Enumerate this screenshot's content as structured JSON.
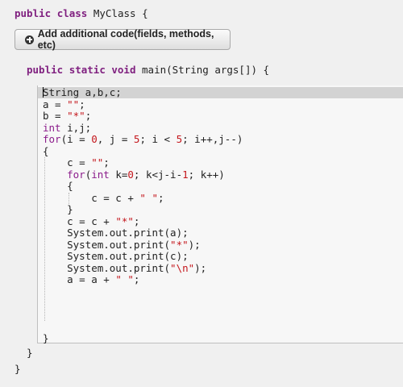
{
  "header": {
    "kw_public": "public",
    "kw_class": "class",
    "class_name": "MyClass",
    "open_brace": "{"
  },
  "add_button": {
    "label": "Add additional code(fields, methods, etc)",
    "icon": "plus-circle-icon"
  },
  "method": {
    "kw_public": "public",
    "kw_static": "static",
    "kw_void": "void",
    "signature": "main(String args[]) {",
    "close_brace": "}"
  },
  "class_close": "}",
  "editor": {
    "lines": [
      [
        {
          "t": "String a,b,c;",
          "c": "plain",
          "cursor": true
        }
      ],
      [
        {
          "t": "a = ",
          "c": "plain"
        },
        {
          "t": "\"\"",
          "c": "str"
        },
        {
          "t": ";",
          "c": "plain"
        }
      ],
      [
        {
          "t": "b = ",
          "c": "plain"
        },
        {
          "t": "\"*\"",
          "c": "str"
        },
        {
          "t": ";",
          "c": "plain"
        }
      ],
      [
        {
          "t": "int",
          "c": "kw2"
        },
        {
          "t": " i,j;",
          "c": "plain"
        }
      ],
      [
        {
          "t": "for",
          "c": "kw2"
        },
        {
          "t": "(i = ",
          "c": "plain"
        },
        {
          "t": "0",
          "c": "num"
        },
        {
          "t": ", j = ",
          "c": "plain"
        },
        {
          "t": "5",
          "c": "num"
        },
        {
          "t": "; i < ",
          "c": "plain"
        },
        {
          "t": "5",
          "c": "num"
        },
        {
          "t": "; i++,j--)",
          "c": "plain"
        }
      ],
      [
        {
          "t": "{",
          "c": "plain"
        }
      ],
      [
        {
          "t": "    c = ",
          "c": "plain"
        },
        {
          "t": "\"\"",
          "c": "str"
        },
        {
          "t": ";",
          "c": "plain"
        }
      ],
      [
        {
          "t": "    ",
          "c": "plain"
        },
        {
          "t": "for",
          "c": "kw2"
        },
        {
          "t": "(",
          "c": "plain"
        },
        {
          "t": "int",
          "c": "kw2"
        },
        {
          "t": " k=",
          "c": "plain"
        },
        {
          "t": "0",
          "c": "num"
        },
        {
          "t": "; k<j-i-",
          "c": "plain"
        },
        {
          "t": "1",
          "c": "num"
        },
        {
          "t": "; k++)",
          "c": "plain"
        }
      ],
      [
        {
          "t": "    {",
          "c": "plain"
        }
      ],
      [
        {
          "t": "        c = c + ",
          "c": "plain"
        },
        {
          "t": "\" \"",
          "c": "str"
        },
        {
          "t": ";",
          "c": "plain"
        }
      ],
      [
        {
          "t": "    }",
          "c": "plain"
        }
      ],
      [
        {
          "t": "    c = c + ",
          "c": "plain"
        },
        {
          "t": "\"*\"",
          "c": "str"
        },
        {
          "t": ";",
          "c": "plain"
        }
      ],
      [
        {
          "t": "    System.out.print(a);",
          "c": "plain"
        }
      ],
      [
        {
          "t": "    System.out.print(",
          "c": "plain"
        },
        {
          "t": "\"*\"",
          "c": "str"
        },
        {
          "t": ");",
          "c": "plain"
        }
      ],
      [
        {
          "t": "    System.out.print(c);",
          "c": "plain"
        }
      ],
      [
        {
          "t": "    System.out.print(",
          "c": "plain"
        },
        {
          "t": "\"\\n\"",
          "c": "str"
        },
        {
          "t": ");",
          "c": "plain"
        }
      ],
      [
        {
          "t": "    a = a + ",
          "c": "plain"
        },
        {
          "t": "\" \"",
          "c": "str"
        },
        {
          "t": ";",
          "c": "plain"
        }
      ],
      [],
      [],
      [],
      [],
      [
        {
          "t": "}",
          "c": "plain"
        }
      ]
    ]
  }
}
